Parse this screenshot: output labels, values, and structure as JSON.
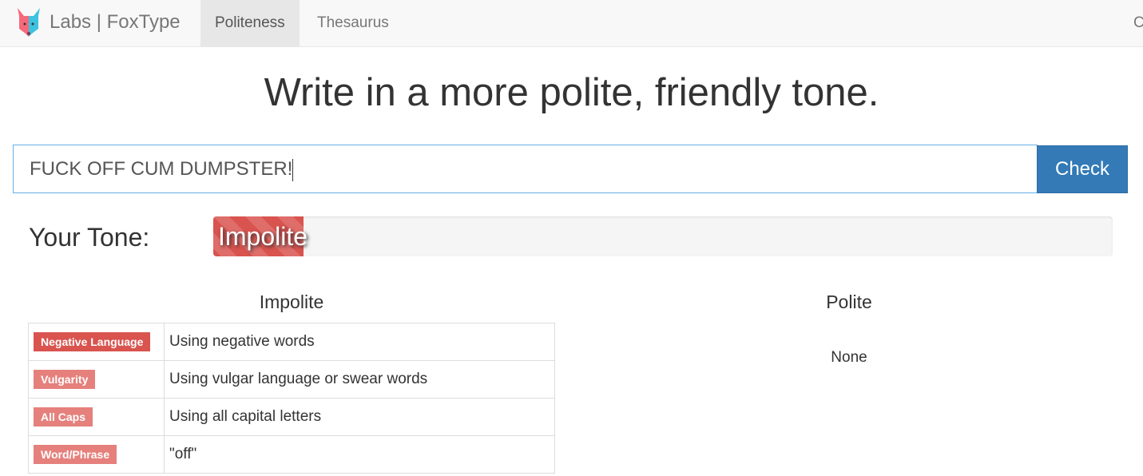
{
  "nav": {
    "brand": "Labs | FoxType",
    "tabs": [
      {
        "label": "Politeness",
        "active": true
      },
      {
        "label": "Thesaurus",
        "active": false
      }
    ],
    "cut_item": "C"
  },
  "heading": "Write in a more polite, friendly tone.",
  "input": {
    "value": "FUCK OFF CUM DUMPSTER!"
  },
  "check_label": "Check",
  "tone": {
    "label": "Your Tone:",
    "value": "Impolite",
    "level_percent": 10,
    "color": "#d9534f"
  },
  "impolite": {
    "title": "Impolite",
    "rows": [
      {
        "label": "Negative Language",
        "desc": "Using negative words",
        "strong": true
      },
      {
        "label": "Vulgarity",
        "desc": "Using vulgar language or swear words",
        "strong": false
      },
      {
        "label": "All Caps",
        "desc": "Using all capital letters",
        "strong": false
      },
      {
        "label": "Word/Phrase",
        "desc": "\"off\"",
        "strong": false
      }
    ]
  },
  "polite": {
    "title": "Polite",
    "value": "None"
  },
  "colors": {
    "primary": "#337ab7",
    "danger": "#d9534f",
    "danger_light": "#e5807c"
  }
}
